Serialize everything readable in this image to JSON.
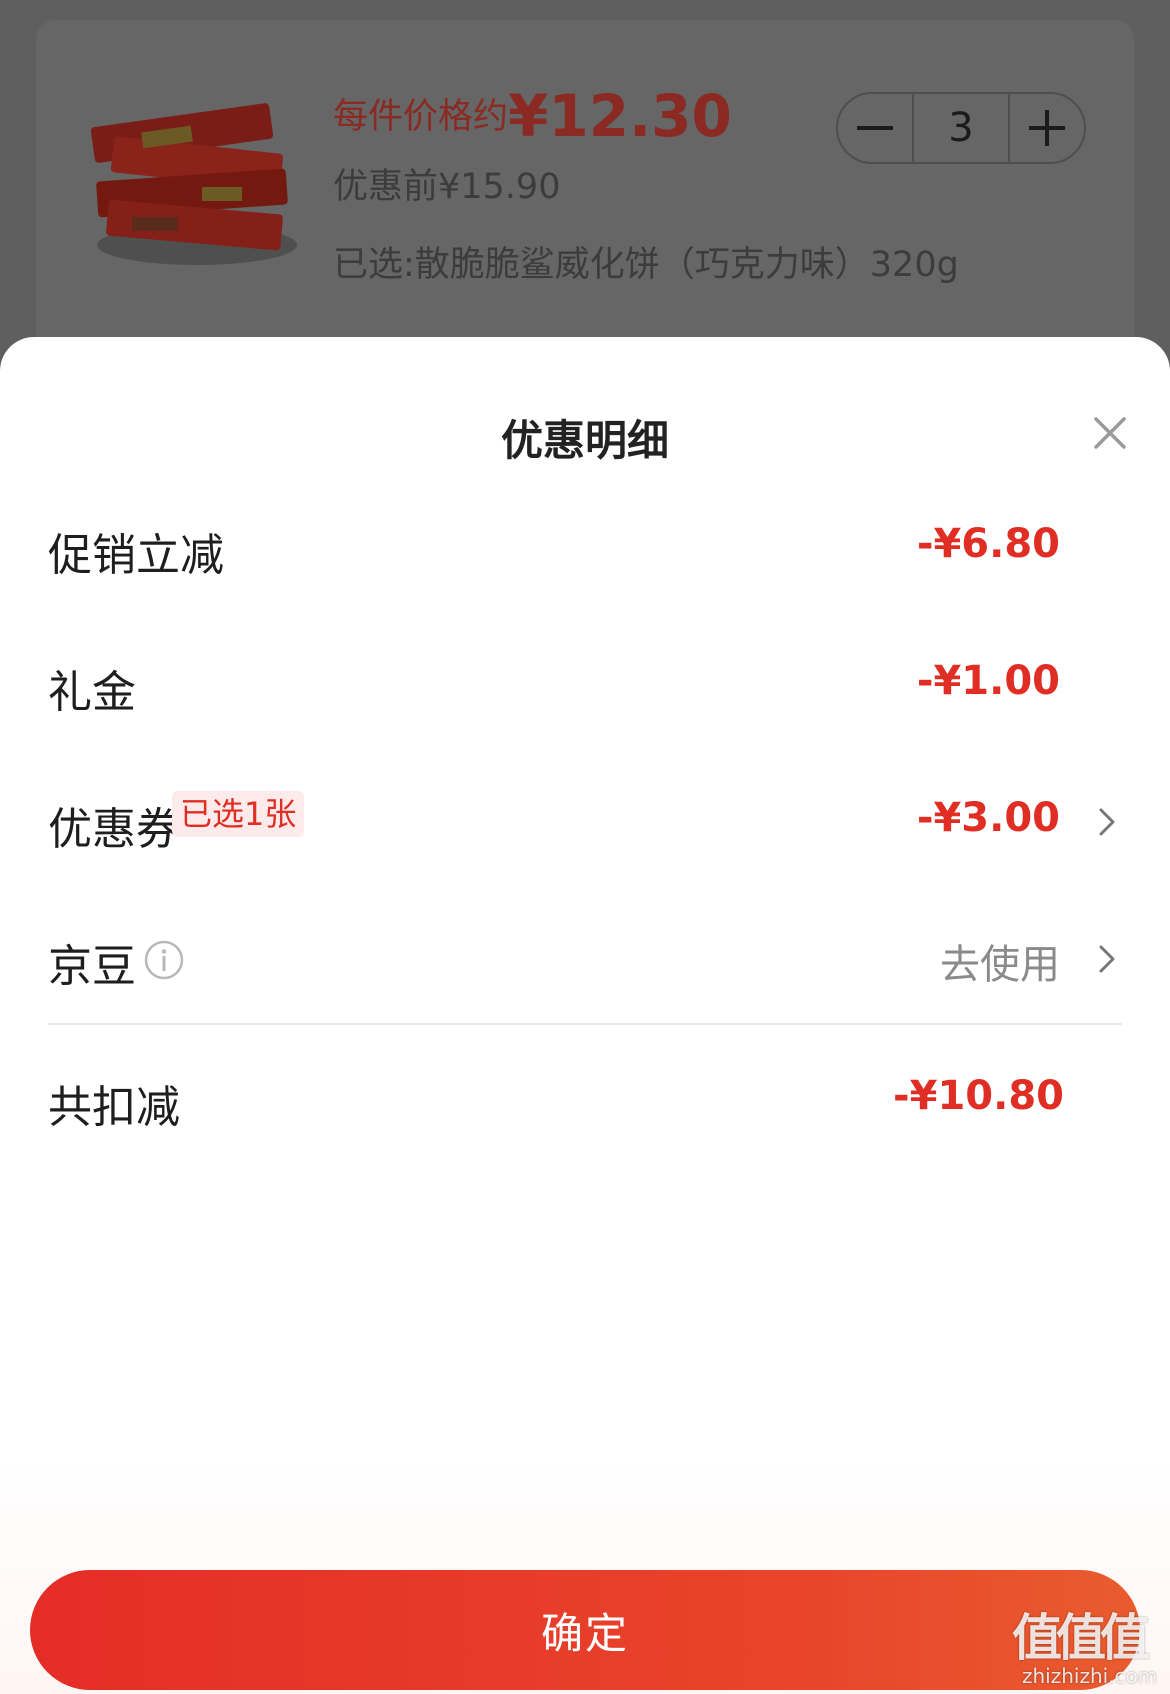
{
  "product": {
    "price_prefix": "每件价格约",
    "price_value": "¥12.30",
    "original_price": "优惠前¥15.90",
    "selected_sku": "已选:散脆脆鲨威化饼（巧克力味）320g",
    "quantity": "3"
  },
  "sheet": {
    "title": "优惠明细",
    "rows": [
      {
        "label": "促销立减",
        "value": "-¥6.80"
      },
      {
        "label": "礼金",
        "value": "-¥1.00"
      },
      {
        "label": "优惠券",
        "badge": "已选1张",
        "value": "-¥3.00"
      },
      {
        "label": "京豆",
        "value": "去使用"
      }
    ],
    "total": {
      "label": "共扣减",
      "value": "-¥10.80"
    }
  },
  "confirm_label": "确定",
  "watermark": {
    "logo": "值值值",
    "url": "zhizhizhi.com"
  },
  "colors": {
    "accent": "#e02e24",
    "overlay": "#5f5f5f",
    "button": "#e52d27"
  }
}
